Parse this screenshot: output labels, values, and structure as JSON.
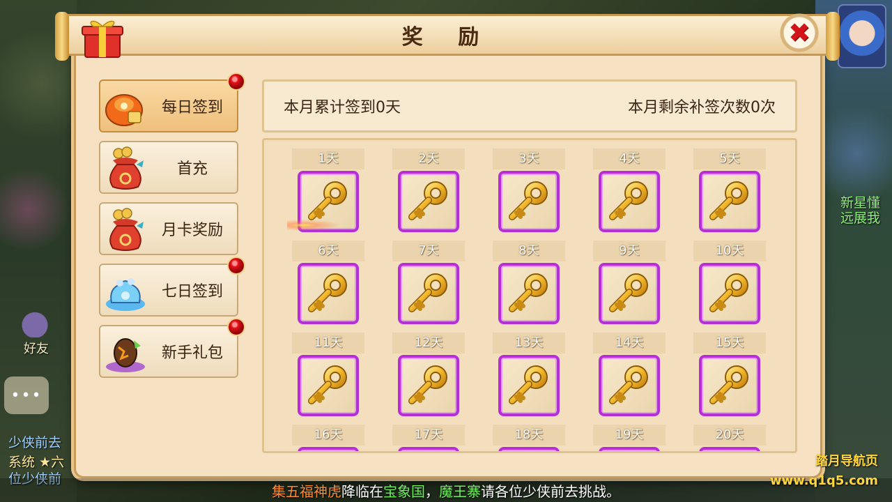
{
  "title": "奖 励",
  "menu": [
    {
      "label": "每日签到",
      "icon": "daily-signin-pouch-icon",
      "badge": true,
      "active": true
    },
    {
      "label": "首充",
      "icon": "lucky-bag-icon",
      "badge": false,
      "active": false
    },
    {
      "label": "月卡奖励",
      "icon": "lucky-bag-icon",
      "badge": false,
      "active": false
    },
    {
      "label": "七日签到",
      "icon": "blue-treasure-icon",
      "badge": true,
      "active": false
    },
    {
      "label": "新手礼包",
      "icon": "magic-egg-icon",
      "badge": true,
      "active": false
    }
  ],
  "info": {
    "monthly_signed": "本月累计签到0天",
    "makeup_remaining": "本月剩余补签次数0次"
  },
  "days": [
    "1天",
    "2天",
    "3天",
    "4天",
    "5天",
    "6天",
    "7天",
    "8天",
    "9天",
    "10天",
    "11天",
    "12天",
    "13天",
    "14天",
    "15天",
    "16天",
    "17天",
    "18天",
    "19天",
    "20天"
  ],
  "reward_icon": "golden-key-icon",
  "background": {
    "friend_label": "好友",
    "chat_lines": [
      "少侠前去",
      "系统 ★六",
      "位少侠前"
    ],
    "right_text": "新星懂\n远展我"
  },
  "broadcast": {
    "part1": "集五福神虎",
    "part2": "降临在",
    "part3": "宝象国",
    "part4": "，",
    "part5": "魔王寨",
    "part6": "请各位少侠前去挑战。"
  },
  "watermark": {
    "line1": "踏月导航页",
    "line2": "www.q1q5.com"
  },
  "colors": {
    "slot_border": "#b62ed6",
    "badge": "#e2141c",
    "title": "#4a2a10"
  }
}
